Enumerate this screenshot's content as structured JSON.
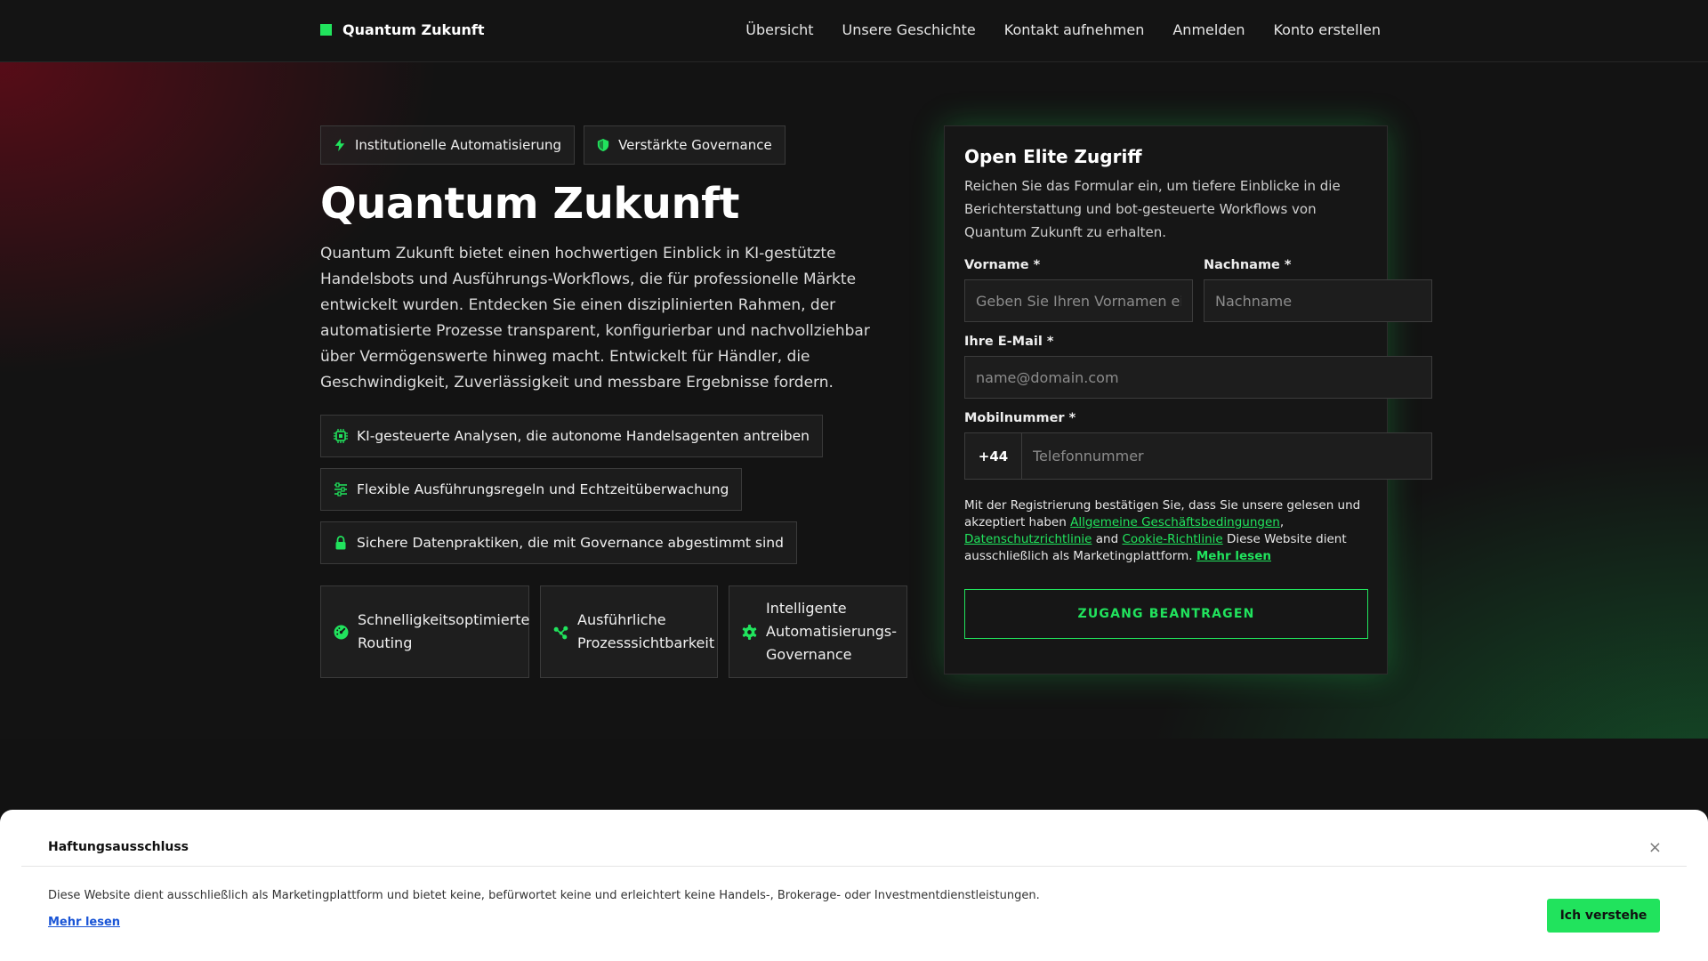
{
  "colors": {
    "accent": "#21e35d",
    "background": "#121212",
    "panel": "#161616",
    "link": "#1a55d6"
  },
  "brand": {
    "name": "Quantum Zukunft",
    "mark_icon": "square-logo-icon"
  },
  "nav": [
    "Übersicht",
    "Unsere Geschichte",
    "Kontakt aufnehmen",
    "Anmelden",
    "Konto erstellen"
  ],
  "pills": [
    {
      "icon": "lightning-icon",
      "label": "Institutionelle Automatisierung"
    },
    {
      "icon": "shield-icon",
      "label": "Verstärkte Governance"
    }
  ],
  "hero": {
    "title": "Quantum Zukunft",
    "description": "Quantum Zukunft bietet einen hochwertigen Einblick in KI-gestützte Handelsbots und Ausführungs-Workflows, die für professionelle Märkte entwickelt wurden. Entdecken Sie einen disziplinierten Rahmen, der automatisierte Prozesse transparent, konfigurierbar und nachvollziehbar über Vermögenswerte hinweg macht. Entwickelt für Händler, die Geschwindigkeit, Zuverlässigkeit und messbare Ergebnisse fordern."
  },
  "features": [
    {
      "icon": "chip-icon",
      "label": "KI-gesteuerte Analysen, die autonome Handelsagenten antreiben"
    },
    {
      "icon": "sliders-icon",
      "label": "Flexible Ausführungsregeln und Echtzeitüberwachung"
    },
    {
      "icon": "lock-icon",
      "label": "Sichere Datenpraktiken, die mit Governance abgestimmt sind"
    }
  ],
  "cards": [
    {
      "icon": "gauge-icon",
      "line1": "Schnelligkeitsoptimierte",
      "line2": "Routing",
      "line3": ""
    },
    {
      "icon": "share-nodes-icon",
      "line1": "Ausführliche",
      "line2": "Prozesssichtbarkeit",
      "line3": ""
    },
    {
      "icon": "gear-icon",
      "line1": "Intelligente",
      "line2": "Automatisierungs-",
      "line3": "Governance"
    }
  ],
  "form": {
    "title": "Open Elite Zugriff",
    "description": "Reichen Sie das Formular ein, um tiefere Einblicke in die Berichterstattung und bot-gesteuerte Workflows von Quantum Zukunft zu erhalten.",
    "first_name_label": "Vorname *",
    "first_name_placeholder": "Geben Sie Ihren Vornamen ein",
    "last_name_label": "Nachname *",
    "last_name_placeholder": "Nachname",
    "email_label": "Ihre E-Mail *",
    "email_placeholder": "name@domain.com",
    "phone_label": "Mobilnummer *",
    "phone_code": "+44",
    "phone_placeholder": "Telefonnummer",
    "consent_prefix": "Mit der Registrierung bestätigen Sie, dass Sie unsere gelesen und akzeptiert haben",
    "terms_link": "Allgemeine Geschäftsbedingungen",
    "comma": ",",
    "privacy_link": "Datenschutzrichtlinie",
    "and_word": "and",
    "cookie_link": "Cookie-Richtlinie",
    "consent_suffix": "Diese Website dient ausschließlich als Marketingplattform.",
    "more_link": "Mehr lesen",
    "submit_label": "ZUGANG BEANTRAGEN"
  },
  "disclaimer": {
    "title": "Haftungsausschluss",
    "close": "×",
    "text": "Diese Website dient ausschließlich als Marketingplattform und bietet keine, befürwortet keine und erleichtert keine Handels-, Brokerage- oder Investmentdienstleistungen.",
    "more": "Mehr lesen",
    "accept": "Ich verstehe"
  }
}
